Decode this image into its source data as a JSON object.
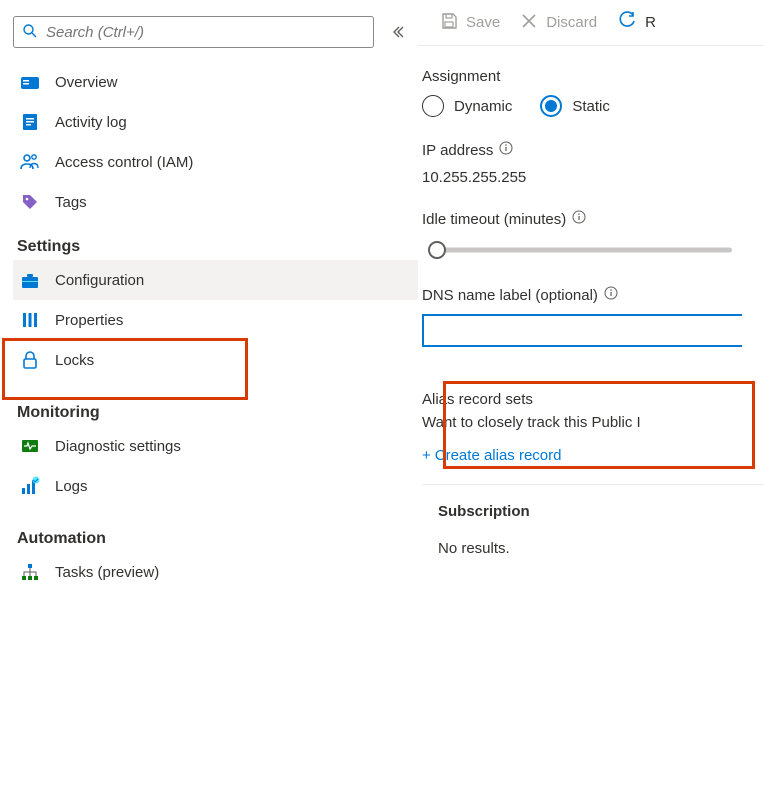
{
  "search": {
    "placeholder": "Search (Ctrl+/)"
  },
  "nav": {
    "overview": "Overview",
    "activity": "Activity log",
    "iam": "Access control (IAM)",
    "tags": "Tags"
  },
  "sections": {
    "settings": "Settings",
    "monitoring": "Monitoring",
    "automation": "Automation"
  },
  "settings_items": {
    "configuration": "Configuration",
    "properties": "Properties",
    "locks": "Locks"
  },
  "monitoring_items": {
    "diagnostic": "Diagnostic settings",
    "logs": "Logs"
  },
  "automation_items": {
    "tasks": "Tasks (preview)"
  },
  "toolbar": {
    "save": "Save",
    "discard": "Discard",
    "refresh": "R"
  },
  "assignment": {
    "label": "Assignment",
    "dynamic": "Dynamic",
    "static": "Static"
  },
  "ip": {
    "label": "IP address",
    "value": "10.255.255.255"
  },
  "idle": {
    "label": "Idle timeout (minutes)"
  },
  "dns": {
    "label": "DNS name label (optional)",
    "value": ""
  },
  "alias": {
    "heading": "Alias record sets",
    "desc": "Want to closely track this Public I",
    "create": "Create alias record"
  },
  "subscription": {
    "label": "Subscription",
    "noresults": "No results."
  }
}
